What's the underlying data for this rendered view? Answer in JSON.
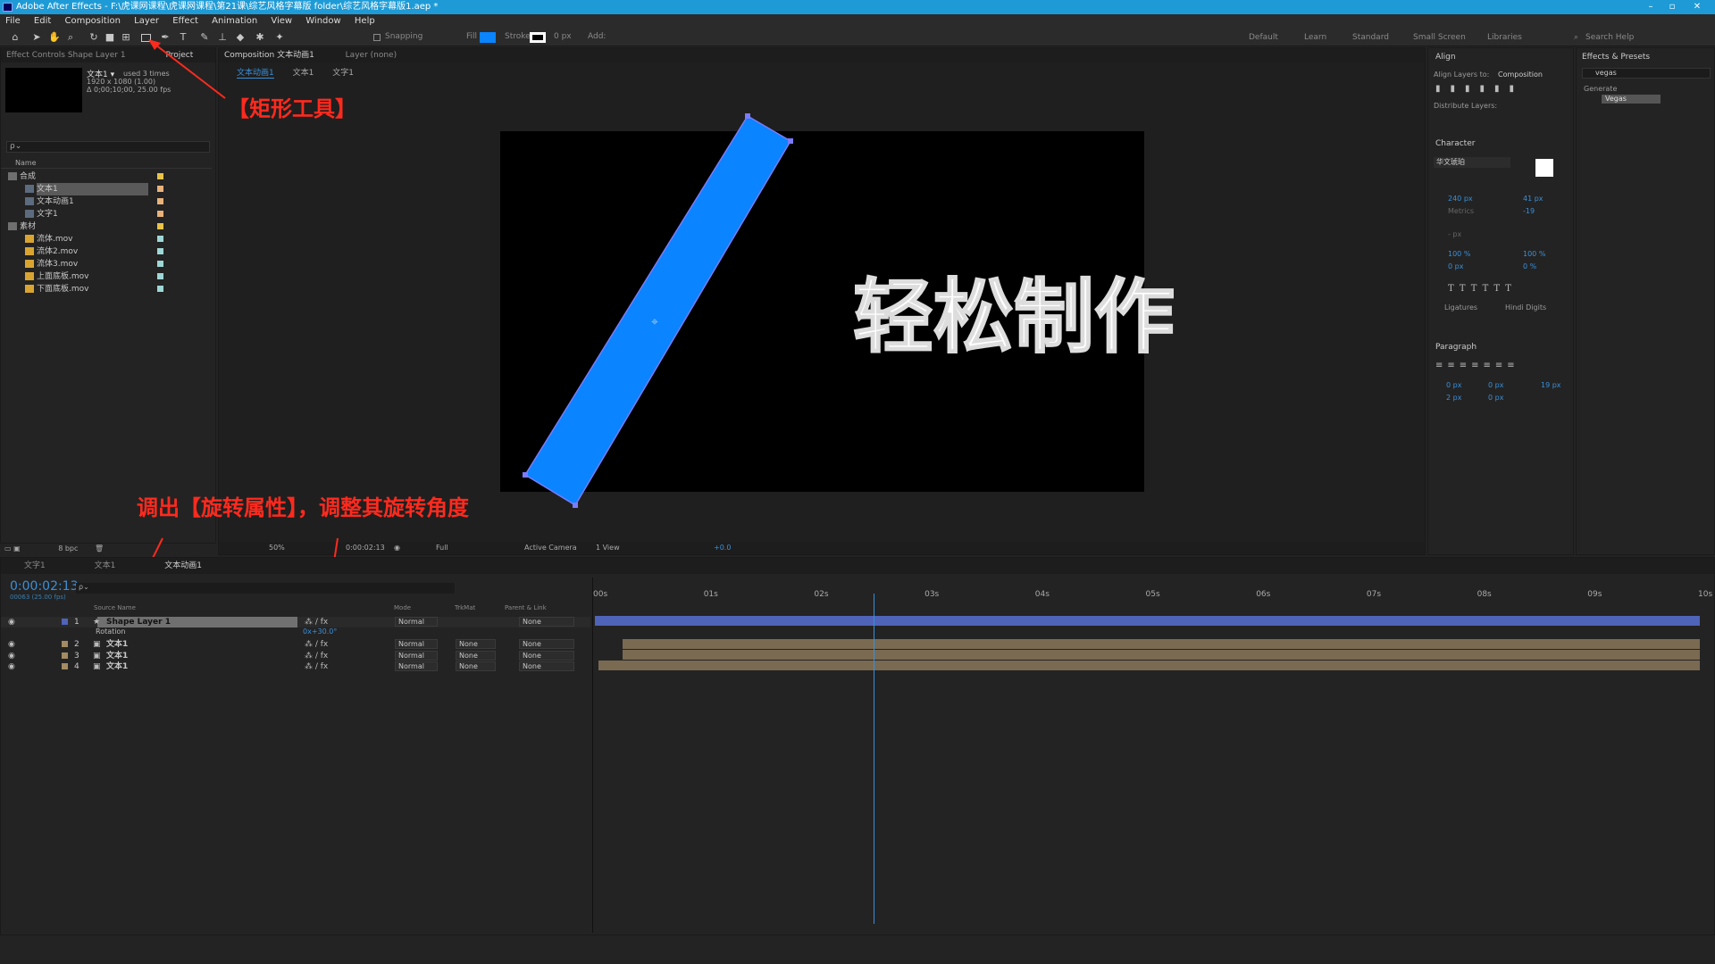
{
  "titlebar": {
    "title": "Adobe After Effects - F:\\虎课网课程\\虎课网课程\\第21课\\综艺风格字幕版 folder\\综艺风格字幕版1.aep *"
  },
  "menu": [
    "File",
    "Edit",
    "Composition",
    "Layer",
    "Effect",
    "Animation",
    "View",
    "Window",
    "Help"
  ],
  "toolbar": {
    "snapping": "Snapping",
    "fill": "Fill",
    "stroke": "Stroke",
    "stroke_px": "0 px",
    "add": "Add:",
    "workspaces": [
      "Default",
      "Learn",
      "Standard",
      "Small Screen",
      "Libraries"
    ],
    "search_help": "Search Help"
  },
  "colors": {
    "accent": "#1e9bd6",
    "shape_fill": "#0a84ff",
    "annotation": "#ff2a1e",
    "layer_bar": "#4f63b8",
    "text_bar": "#7a6a52"
  },
  "project": {
    "tabs": [
      "Effect Controls Shape Layer 1",
      "Project"
    ],
    "selected_name": "文本1 ▾",
    "used": "used 3 times",
    "size": "1920 x 1080 (1.00)",
    "duration": "Δ 0;00;10;00, 25.00 fps",
    "search_placeholder": "ρ⌄",
    "col_name": "Name",
    "items": [
      {
        "name": "合成",
        "type": "folder",
        "indent": 0,
        "label": "#e8c34a"
      },
      {
        "name": "文本1",
        "type": "comp",
        "indent": 1,
        "label": "#e8b27a",
        "selected": true
      },
      {
        "name": "文本动画1",
        "type": "comp",
        "indent": 1,
        "label": "#e8b27a"
      },
      {
        "name": "文字1",
        "type": "comp",
        "indent": 1,
        "label": "#e8b27a"
      },
      {
        "name": "素材",
        "type": "folder",
        "indent": 0,
        "label": "#e8c34a"
      },
      {
        "name": "流体.mov",
        "type": "footage",
        "indent": 1,
        "label": "#9fd7d7"
      },
      {
        "name": "流体2.mov",
        "type": "footage",
        "indent": 1,
        "label": "#9fd7d7"
      },
      {
        "name": "流体3.mov",
        "type": "footage",
        "indent": 1,
        "label": "#9fd7d7"
      },
      {
        "name": "上面底板.mov",
        "type": "footage",
        "indent": 1,
        "label": "#9fd7d7"
      },
      {
        "name": "下面底板.mov",
        "type": "footage",
        "indent": 1,
        "label": "#9fd7d7"
      }
    ],
    "bpc": "8 bpc"
  },
  "composition": {
    "tab_label": "Composition 文本动画1",
    "layer_tab": "Layer (none)",
    "breadcrumbs": [
      "文本动画1",
      "文本1",
      "文字1"
    ],
    "canvas_text": "轻松制作",
    "zoom": "50%",
    "time": "0:00:02:13",
    "resolution": "Full",
    "camera": "Active Camera",
    "view": "1 View",
    "exposure": "+0.0"
  },
  "annotations": {
    "rect_tool": "【矩形工具】",
    "rotation": "调出【旋转属性】，调整其旋转角度"
  },
  "right_panels": {
    "align_title": "Align",
    "align_to_label": "Align Layers to:",
    "align_to_value": "Composition",
    "distribute": "Distribute Layers:",
    "character_title": "Character",
    "font": "华文琥珀",
    "font_size": "240 px",
    "leading": "41 px",
    "kerning": "Metrics",
    "tracking": "-19",
    "stroke_w": "- px",
    "vscale": "100 %",
    "hscale": "100 %",
    "baseline": "0 px",
    "tsume": "0 %",
    "ligatures": "Ligatures",
    "hindi": "Hindi Digits",
    "paragraph_title": "Paragraph",
    "indent_left": "0 px",
    "indent_right": "0 px",
    "space_before": "19 px",
    "first_indent": "2 px",
    "space_after": "0 px",
    "effects_title": "Effects & Presets",
    "effects_search": "vegas",
    "effects_group": "Generate",
    "effects_item": "Vegas"
  },
  "timeline": {
    "tabs": [
      "文字1",
      "文本1",
      "文本动画1"
    ],
    "current_time": "0:00:02:13",
    "frames": "00063 (25.00 fps)",
    "col_source": "Source Name",
    "col_mode": "Mode",
    "col_trkmat": "TrkMat",
    "col_parent": "Parent & Link",
    "rotation_label": "Rotation",
    "rotation_value": "0x+30.0°",
    "layers": [
      {
        "num": "1",
        "name": "Shape Layer 1",
        "mode": "Normal",
        "trk": "",
        "parent": "None",
        "type": "shape"
      },
      {
        "num": "2",
        "name": "文本1",
        "mode": "Normal",
        "trk": "None",
        "parent": "None",
        "type": "comp"
      },
      {
        "num": "3",
        "name": "文本1",
        "mode": "Normal",
        "trk": "None",
        "parent": "None",
        "type": "comp"
      },
      {
        "num": "4",
        "name": "文本1",
        "mode": "Normal",
        "trk": "None",
        "parent": "None",
        "type": "comp"
      }
    ],
    "ruler": [
      "00s",
      "01s",
      "02s",
      "03s",
      "04s",
      "05s",
      "06s",
      "07s",
      "08s",
      "09s",
      "10s"
    ],
    "playhead_seconds": 2.52,
    "duration_seconds": 10
  }
}
